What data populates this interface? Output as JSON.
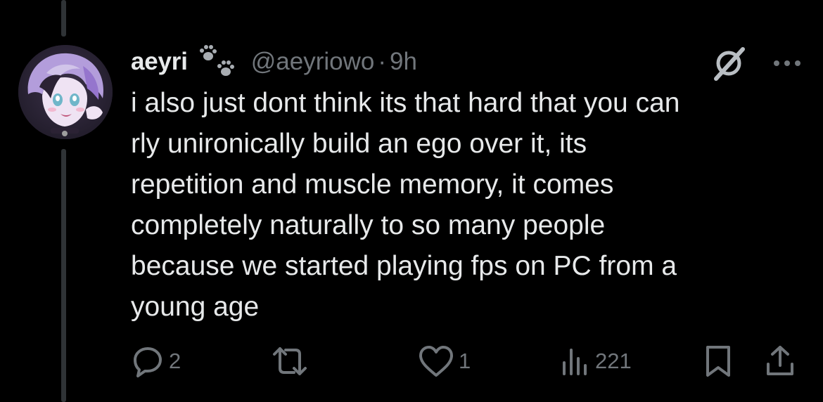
{
  "tweet": {
    "display_name": "aeyri",
    "handle": "@aeyriowo",
    "separator": "·",
    "time": "9h",
    "text_lines": [
      "i also just dont think its that hard that you can",
      "rly unironically build an ego over it, its",
      "repetition and muscle memory, it comes",
      "completely naturally to so many people",
      "because we started playing fps on PC from a",
      "young age"
    ]
  },
  "actions": {
    "replies": {
      "icon": "reply-icon",
      "count": "2"
    },
    "reposts": {
      "icon": "repost-icon",
      "count": ""
    },
    "likes": {
      "icon": "heart-icon",
      "count": "1"
    },
    "views": {
      "icon": "views-icon",
      "count": "221"
    },
    "bookmark": {
      "icon": "bookmark-icon"
    },
    "share": {
      "icon": "share-icon"
    }
  },
  "header_icons": {
    "badge": "paw-prints-icon",
    "grok": "grok-icon",
    "more": "more-icon"
  },
  "colors": {
    "background": "#000000",
    "text": "#e7e9ea",
    "muted": "#71767b",
    "thread_line": "#2f3336",
    "avatar_accent": "#b39ddb"
  }
}
